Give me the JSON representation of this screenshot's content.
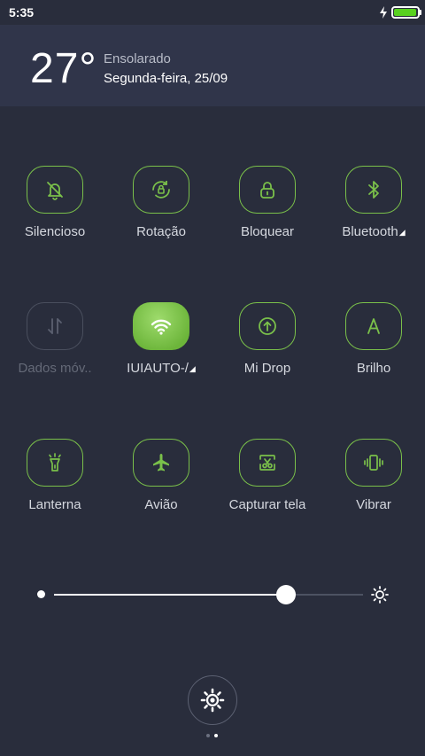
{
  "status_bar": {
    "time": "5:35",
    "battery_color": "#58d11f",
    "battery_level": 0.95
  },
  "weather": {
    "temperature": "27°",
    "condition": "Ensolarado",
    "date": "Segunda-feira, 25/09"
  },
  "accent_color": "#7ac04a",
  "tiles": [
    {
      "label": "Silencioso",
      "icon": "bell-off-icon",
      "state": "on",
      "expand": false
    },
    {
      "label": "Rotação",
      "icon": "rotation-lock-icon",
      "state": "on",
      "expand": false
    },
    {
      "label": "Bloquear",
      "icon": "lock-icon",
      "state": "on",
      "expand": false
    },
    {
      "label": "Bluetooth",
      "icon": "bluetooth-icon",
      "state": "on",
      "expand": true
    },
    {
      "label": "Dados móv..",
      "icon": "mobile-data-icon",
      "state": "disabled",
      "expand": false
    },
    {
      "label": "IUIAUTO-/",
      "icon": "wifi-icon",
      "state": "active",
      "expand": true
    },
    {
      "label": "Mi Drop",
      "icon": "mi-drop-icon",
      "state": "on",
      "expand": false
    },
    {
      "label": "Brilho",
      "icon": "auto-brightness-icon",
      "state": "on",
      "expand": false
    },
    {
      "label": "Lanterna",
      "icon": "flashlight-icon",
      "state": "on",
      "expand": false
    },
    {
      "label": "Avião",
      "icon": "airplane-icon",
      "state": "on",
      "expand": false
    },
    {
      "label": "Capturar tela",
      "icon": "screenshot-icon",
      "state": "on",
      "expand": false
    },
    {
      "label": "Vibrar",
      "icon": "vibrate-icon",
      "state": "on",
      "expand": false
    }
  ],
  "brightness": {
    "level": 0.75
  },
  "settings": {
    "icon": "gear-icon"
  },
  "pager": {
    "pages": 2,
    "current": 1
  }
}
